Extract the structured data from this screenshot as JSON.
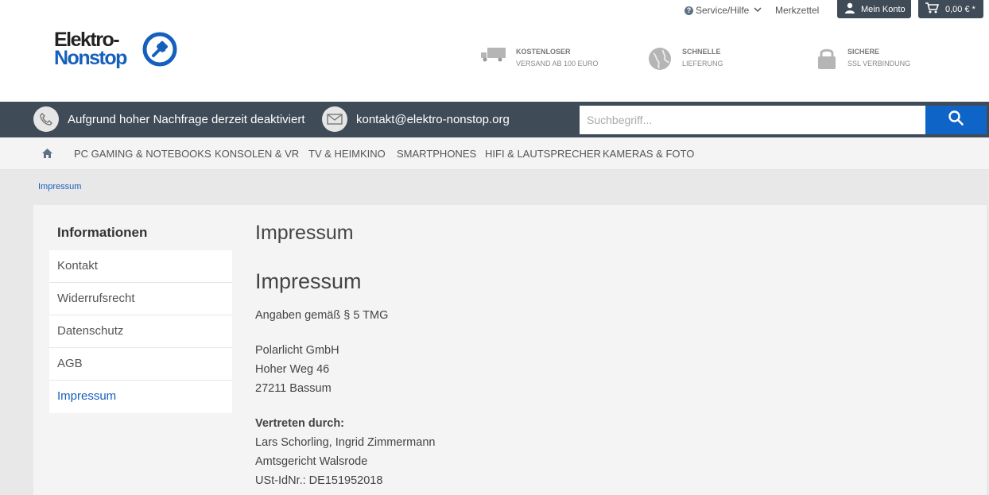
{
  "topbar": {
    "service_label": "Service/Hilfe",
    "merkzettel_label": "Merkzettel",
    "konto_label": "Mein Konto",
    "cart_label": "0,00 € *"
  },
  "logo": {
    "line1": "Elektro-",
    "line2": "Nonstop"
  },
  "usps": [
    {
      "title": "KOSTENLOSER",
      "subtitle": "VERSAND AB 100 EURO",
      "icon": "truck-icon"
    },
    {
      "title": "SCHNELLE",
      "subtitle": "LIEFERUNG",
      "icon": "globe-icon"
    },
    {
      "title": "SICHERE",
      "subtitle": "SSL VERBINDUNG",
      "icon": "lock-icon"
    }
  ],
  "contactbar": {
    "phone_text": "Aufgrund hoher Nachfrage derzeit deaktiviert",
    "email_text": "kontakt@elektro-nonstop.org",
    "search_placeholder": "Suchbegriff..."
  },
  "nav": {
    "items": [
      "PC GAMING & NOTEBOOKS",
      "KONSOLEN & VR",
      "TV & HEIMKINO",
      "SMARTPHONES",
      "HIFI & LAUTSPRECHER",
      "KAMERAS & FOTO"
    ]
  },
  "breadcrumb": "Impressum",
  "sidebar": {
    "title": "Informationen",
    "items": [
      "Kontakt",
      "Widerrufsrecht",
      "Datenschutz",
      "AGB",
      "Impressum"
    ],
    "active_index": 4
  },
  "main": {
    "title": "Impressum",
    "heading": "Impressum",
    "intro": "Angaben gemäß § 5 TMG",
    "company": "Polarlicht GmbH",
    "street": "Hoher Weg 46",
    "city": "27211 Bassum",
    "represented_label": "Vertreten durch:",
    "representatives": "Lars Schorling, Ingrid Zimmermann",
    "court": "Amtsgericht Walsrode",
    "vat": "USt-IdNr.: DE151952018"
  },
  "colors": {
    "accent": "#1560bd",
    "dark_bar": "#3f4c58",
    "search_button": "#0f64c8"
  }
}
